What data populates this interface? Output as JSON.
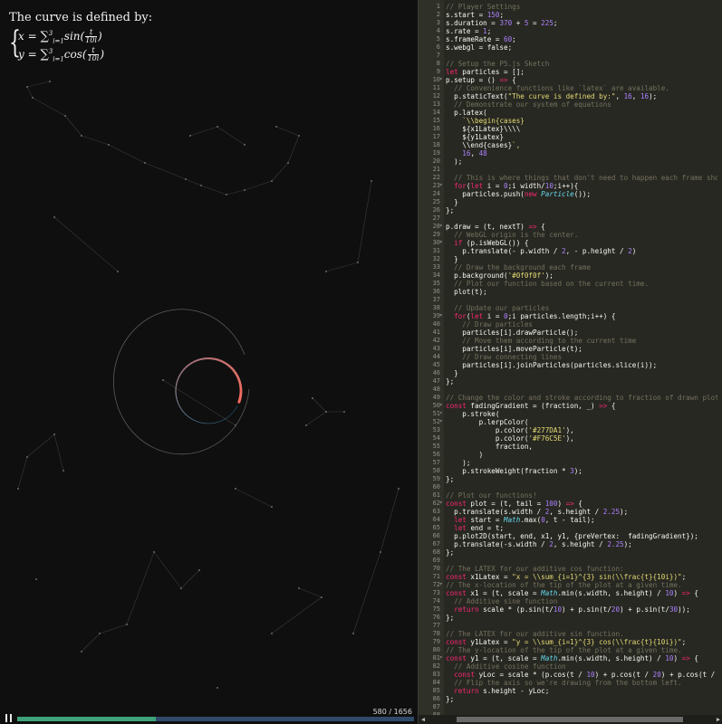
{
  "canvas": {
    "title": "The curve is defined by:",
    "equation_x": {
      "lhs": "x",
      "sum_top": "3",
      "sum_bottom": "i=1",
      "fn": "sin",
      "num": "t",
      "den": "10i"
    },
    "equation_y": {
      "lhs": "y",
      "sum_top": "3",
      "sum_bottom": "i=1",
      "fn": "cos",
      "num": "t",
      "den": "10i"
    },
    "gradient_colors": [
      "#277DA1",
      "#F76C5E"
    ]
  },
  "player": {
    "frame_counter": "580 / 1656",
    "progress": 0.35
  },
  "editor": {
    "lines": [
      "// Player Settings",
      "s.start = 150;",
      "s.duration = 370 + 5 = 225;",
      "s.rate = 1;",
      "s.frameRate = 60;",
      "s.webgl = false;",
      "",
      "// Setup the P5.js Sketch",
      "let particles = [];",
      "p.setup = () => {",
      "  // Convenience functions like `latex` are available.",
      "  p.staticText(\"The curve is defined by:\", 16, 16);",
      "  // Demonstrate our system of equations",
      "  p.latex(",
      "    `\\\\begin{cases}",
      "    ${x1Latex}\\\\\\\\",
      "    ${y1Latex}",
      "    \\\\end{cases}`,",
      "    16, 48",
      "  );",
      "",
      "  // This is where things that don't need to happen each frame should",
      "  for(let i = 0;i width/10;i++){",
      "    particles.push(new Particle());",
      "  }",
      "};",
      "",
      "p.draw = (t, nextT) => {",
      "  // WebGL origin is the center.",
      "  if (p.isWebGL()) {",
      "    p.translate(- p.width / 2, - p.height / 2)",
      "  }",
      "  // Draw the background each frame",
      "  p.background('#0f0f0f');",
      "  // Plot our function based on the current time.",
      "  plot(t);",
      "",
      "  // Update our particles",
      "  for(let i = 0;i particles.length;i++) {",
      "    // Draw particles",
      "    particles[i].drawParticle();",
      "    // Move them according to the current time",
      "    particles[i].moveParticle(t);",
      "    // Draw connecting lines",
      "    particles[i].joinParticles(particles.slice(i));",
      "  }",
      "};",
      "",
      "// Change the color and stroke according to fraction of drawn plot.",
      "const fadingGradient = (fraction, _) => {",
      "    p.stroke(",
      "        p.lerpColor(",
      "            p.color('#277DA1'),",
      "            p.color('#F76C5E'),",
      "            fraction,",
      "        )",
      "    );",
      "    p.strokeWeight(fraction * 3);",
      "};",
      "",
      "// Plot our functions!",
      "const plot = (t, tail = 100) => {",
      "  p.translate(s.width / 2, s.height / 2.25);",
      "  let start = Math.max(0, t - tail);",
      "  let end = t;",
      "  p.plot2D(start, end, x1, y1, {preVertex:  fadingGradient});",
      "  p.translate(-s.width / 2, s.height / 2.25);",
      "};",
      "",
      "// The LATEX for our additive cos function:",
      "const x1Latex = \"x = \\\\sum_{i=1}^{3} sin(\\\\frac{t}{10i})\";",
      "// The x-location of the tip of the plot at a given time.",
      "const x1 = (t, scale = Math.min(s.width, s.height) / 10) => {",
      "  // Additive sine function",
      "  return scale * (p.sin(t/10) + p.sin(t/20) + p.sin(t/30));",
      "};",
      "",
      "// The LATEX for our additive sin function.",
      "const y1Latex = \"y = \\\\sum_{i=1}^{3} cos(\\\\frac{t}{10i})\";",
      "// The y-location of the tip of the plot at a given time.",
      "const y1 = (t, scale = Math.min(s.width, s.height) / 10) => {",
      "  // Additive cosine function",
      "  const yLoc = scale * (p.cos(t / 10) + p.cos(t / 20) + p.cos(t / 30));",
      "  // Flip the axis so we're drawing from the bottom left.",
      "  return s.height - yLoc;",
      "};",
      "",
      ""
    ],
    "fold_lines": [
      10,
      23,
      28,
      30,
      39,
      50,
      51,
      52,
      62,
      72,
      81
    ]
  }
}
